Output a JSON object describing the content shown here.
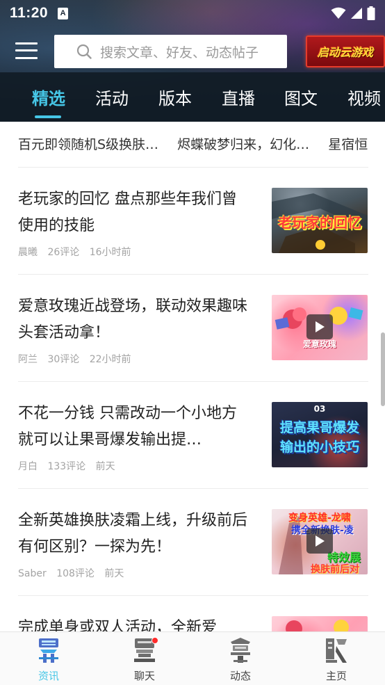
{
  "status_bar": {
    "time": "11:20",
    "app_icon_letter": "A"
  },
  "header": {
    "search": {
      "placeholder": "搜索文章、好友、动态帖子"
    },
    "cloud_game_label": "启动云游戏"
  },
  "tabs": [
    {
      "label": "精选",
      "active": true
    },
    {
      "label": "活动",
      "active": false
    },
    {
      "label": "版本",
      "active": false
    },
    {
      "label": "直播",
      "active": false
    },
    {
      "label": "图文",
      "active": false
    },
    {
      "label": "视频",
      "active": false
    }
  ],
  "ticker": [
    "百元即领随机S级换肤…",
    "烬蝶破梦归来，幻化…",
    "星宿恒"
  ],
  "articles": [
    {
      "title": "老玩家的回忆 盘点那些年我们曾使用的技能",
      "author": "晨曦",
      "comments": "26评论",
      "time": "16小时前",
      "thumb_text": "老玩家的回忆",
      "has_video": false
    },
    {
      "title": "爱意玫瑰近战登场，联动效果趣味头套活动拿！",
      "author": "阿兰",
      "comments": "30评论",
      "time": "22小时前",
      "thumb_text": "爱意玫瑰",
      "has_video": true
    },
    {
      "title": "不花一分钱 只需改动一个小地方 就可以让果哥爆发输出提…",
      "author": "月白",
      "comments": "133评论",
      "time": "前天",
      "thumb_text": "提高果哥爆发",
      "thumb_text_2": "输出的小技巧",
      "thumb_badge": "03",
      "has_video": false
    },
    {
      "title": "全新英雄换肤凌霜上线，升级前后有何区别？一探为先！",
      "author": "Saber",
      "comments": "108评论",
      "time": "前天",
      "thumb_text": "变身英雄-龙啸",
      "thumb_text_2": "携全新换肤-凌",
      "thumb_text_3": "特效展",
      "thumb_text_4": "换肤前后对",
      "has_video": true
    },
    {
      "title": "完成单身或双人活动，全新爱",
      "author": "",
      "comments": "",
      "time": "",
      "has_video": false
    }
  ],
  "bottom_nav": [
    {
      "label": "资讯",
      "icon": "news-glyph-icon",
      "active": true,
      "badge": false
    },
    {
      "label": "聊天",
      "icon": "chat-glyph-icon",
      "active": false,
      "badge": true
    },
    {
      "label": "动态",
      "icon": "feed-glyph-icon",
      "active": false,
      "badge": false
    },
    {
      "label": "主页",
      "icon": "home-glyph-icon",
      "active": false,
      "badge": false
    }
  ],
  "colors": {
    "accent": "#46c6e6",
    "header_dark": "#15212d",
    "badge_red": "#ff2a2a",
    "cloud_button": "#b0191c"
  }
}
